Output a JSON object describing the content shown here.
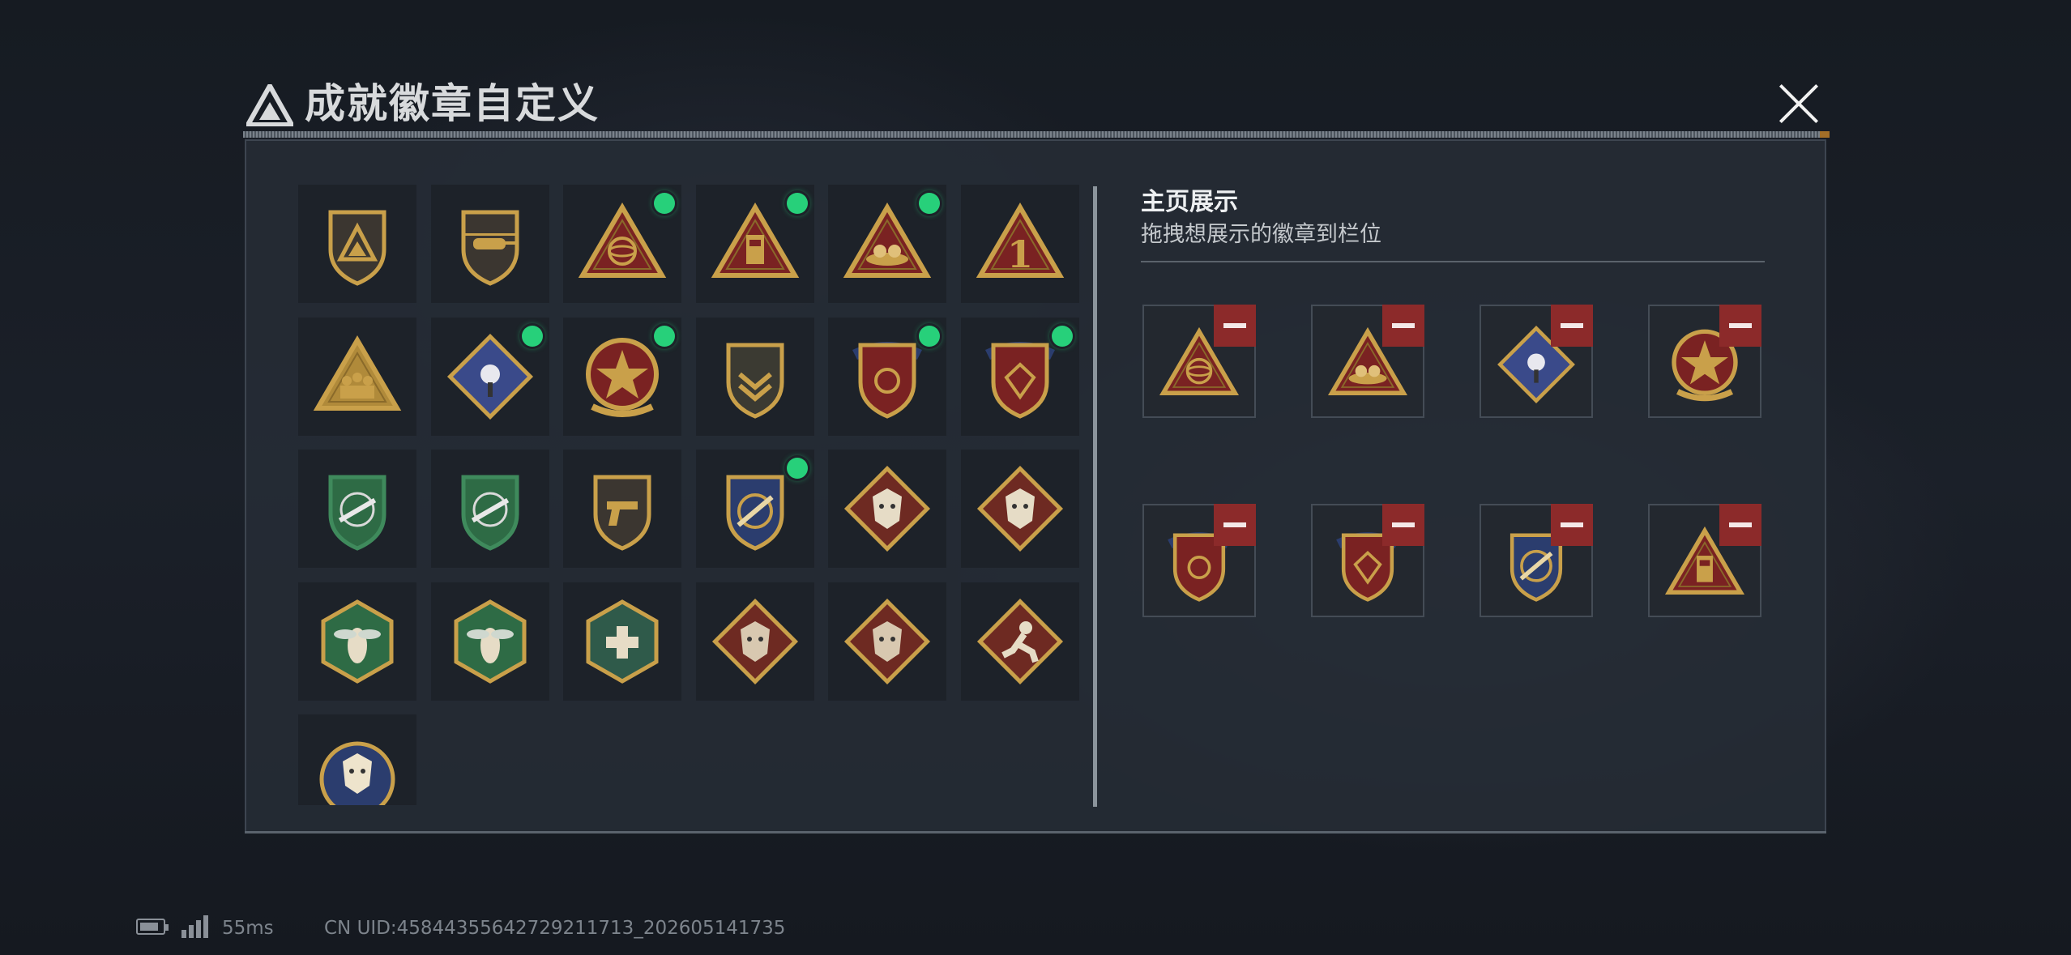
{
  "header": {
    "title": "成就徽章自定义",
    "logo_icon": "delta-triangle-logo",
    "close_icon": "close-icon"
  },
  "grid": {
    "badges": [
      {
        "icon": "shield-delta-badge",
        "new": false
      },
      {
        "icon": "helicopter-shield-badge",
        "new": false
      },
      {
        "icon": "globe-triangle-badge",
        "new": true
      },
      {
        "icon": "building-triangle-badge",
        "new": true
      },
      {
        "icon": "nest-triangle-badge",
        "new": true
      },
      {
        "icon": "number-one-triangle-badge",
        "new": false
      },
      {
        "icon": "squad-triangle-badge",
        "new": false
      },
      {
        "icon": "rose-diamond-badge",
        "new": true
      },
      {
        "icon": "star-wreath-badge",
        "new": true
      },
      {
        "icon": "chevron-shield-badge",
        "new": false
      },
      {
        "icon": "eagle-crest-badge",
        "new": true
      },
      {
        "icon": "gem-crest-badge",
        "new": true
      },
      {
        "icon": "rifle-green-shield-badge",
        "new": false
      },
      {
        "icon": "rifle-green-shield-badge-2",
        "new": false
      },
      {
        "icon": "pistol-shield-badge",
        "new": false
      },
      {
        "icon": "sword-blue-shield-badge",
        "new": true
      },
      {
        "icon": "wolf-diamond-badge",
        "new": false
      },
      {
        "icon": "wolf-diamond-badge-2",
        "new": false
      },
      {
        "icon": "wasp-hexagon-badge",
        "new": false
      },
      {
        "icon": "wasp-hexagon-badge-2",
        "new": false
      },
      {
        "icon": "medkit-hexagon-badge",
        "new": false
      },
      {
        "icon": "dragon-diamond-badge",
        "new": false
      },
      {
        "icon": "dragon-diamond-badge-2",
        "new": false
      },
      {
        "icon": "runner-diamond-badge",
        "new": false
      },
      {
        "icon": "lynx-circle-badge",
        "new": false
      }
    ]
  },
  "showcase": {
    "title": "主页展示",
    "subtitle": "拖拽想展示的徽章到栏位",
    "slots": [
      {
        "icon": "globe-triangle-badge"
      },
      {
        "icon": "nest-triangle-badge"
      },
      {
        "icon": "rose-diamond-badge"
      },
      {
        "icon": "star-wreath-badge"
      },
      {
        "icon": "eagle-crest-badge"
      },
      {
        "icon": "gem-crest-badge"
      },
      {
        "icon": "sword-blue-shield-badge"
      },
      {
        "icon": "building-triangle-badge"
      }
    ]
  },
  "status_bar": {
    "ping": "55ms",
    "uid": "CN UID:4584435564272921​1713_202605141735"
  },
  "colors": {
    "new_dot": "#27d07a",
    "remove": "#8c2a2a",
    "gold": "#c9a04a"
  }
}
